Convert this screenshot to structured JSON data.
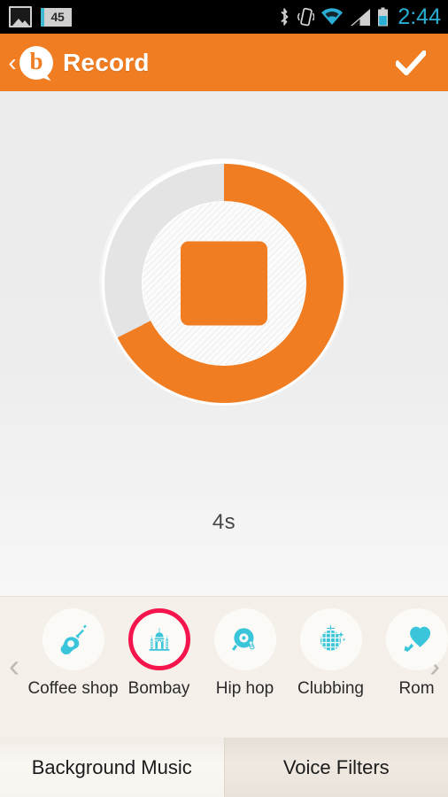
{
  "theme": {
    "accent": "#f07d22",
    "select_ring": "#f5144b",
    "icon_teal": "#3bc5da",
    "status_time_color": "#2aaed4"
  },
  "status_bar": {
    "image_icon": "image-icon",
    "notification_badge": "45",
    "bluetooth_icon": "bluetooth-icon",
    "vibrate_icon": "vibrate-icon",
    "wifi_icon": "wifi-icon",
    "signal_icon": "cellular-signal-icon",
    "battery_icon": "battery-icon",
    "time": "2:44"
  },
  "action_bar": {
    "back_chevron": "‹",
    "logo_letter": "b",
    "logo_icon": "speech-bubble-logo",
    "title": "Record",
    "confirm_icon": "checkmark-icon"
  },
  "record": {
    "progress_degrees": 243,
    "stop_button_icon": "stop-square-icon",
    "timer": "4s"
  },
  "carousel": {
    "prev_arrow": "‹",
    "next_arrow": "›",
    "items": [
      {
        "label": "Coffee shop",
        "icon": "guitar-icon",
        "selected": false
      },
      {
        "label": "Bombay",
        "icon": "taj-mahal-icon",
        "selected": true
      },
      {
        "label": "Hip hop",
        "icon": "turntable-icon",
        "selected": false
      },
      {
        "label": "Clubbing",
        "icon": "disco-ball-icon",
        "selected": false
      },
      {
        "label": "Rom",
        "icon": "cupid-arrow-icon",
        "selected": false
      }
    ]
  },
  "bottom_tabs": [
    {
      "label": "Background Music",
      "active": true
    },
    {
      "label": "Voice Filters",
      "active": false
    }
  ]
}
